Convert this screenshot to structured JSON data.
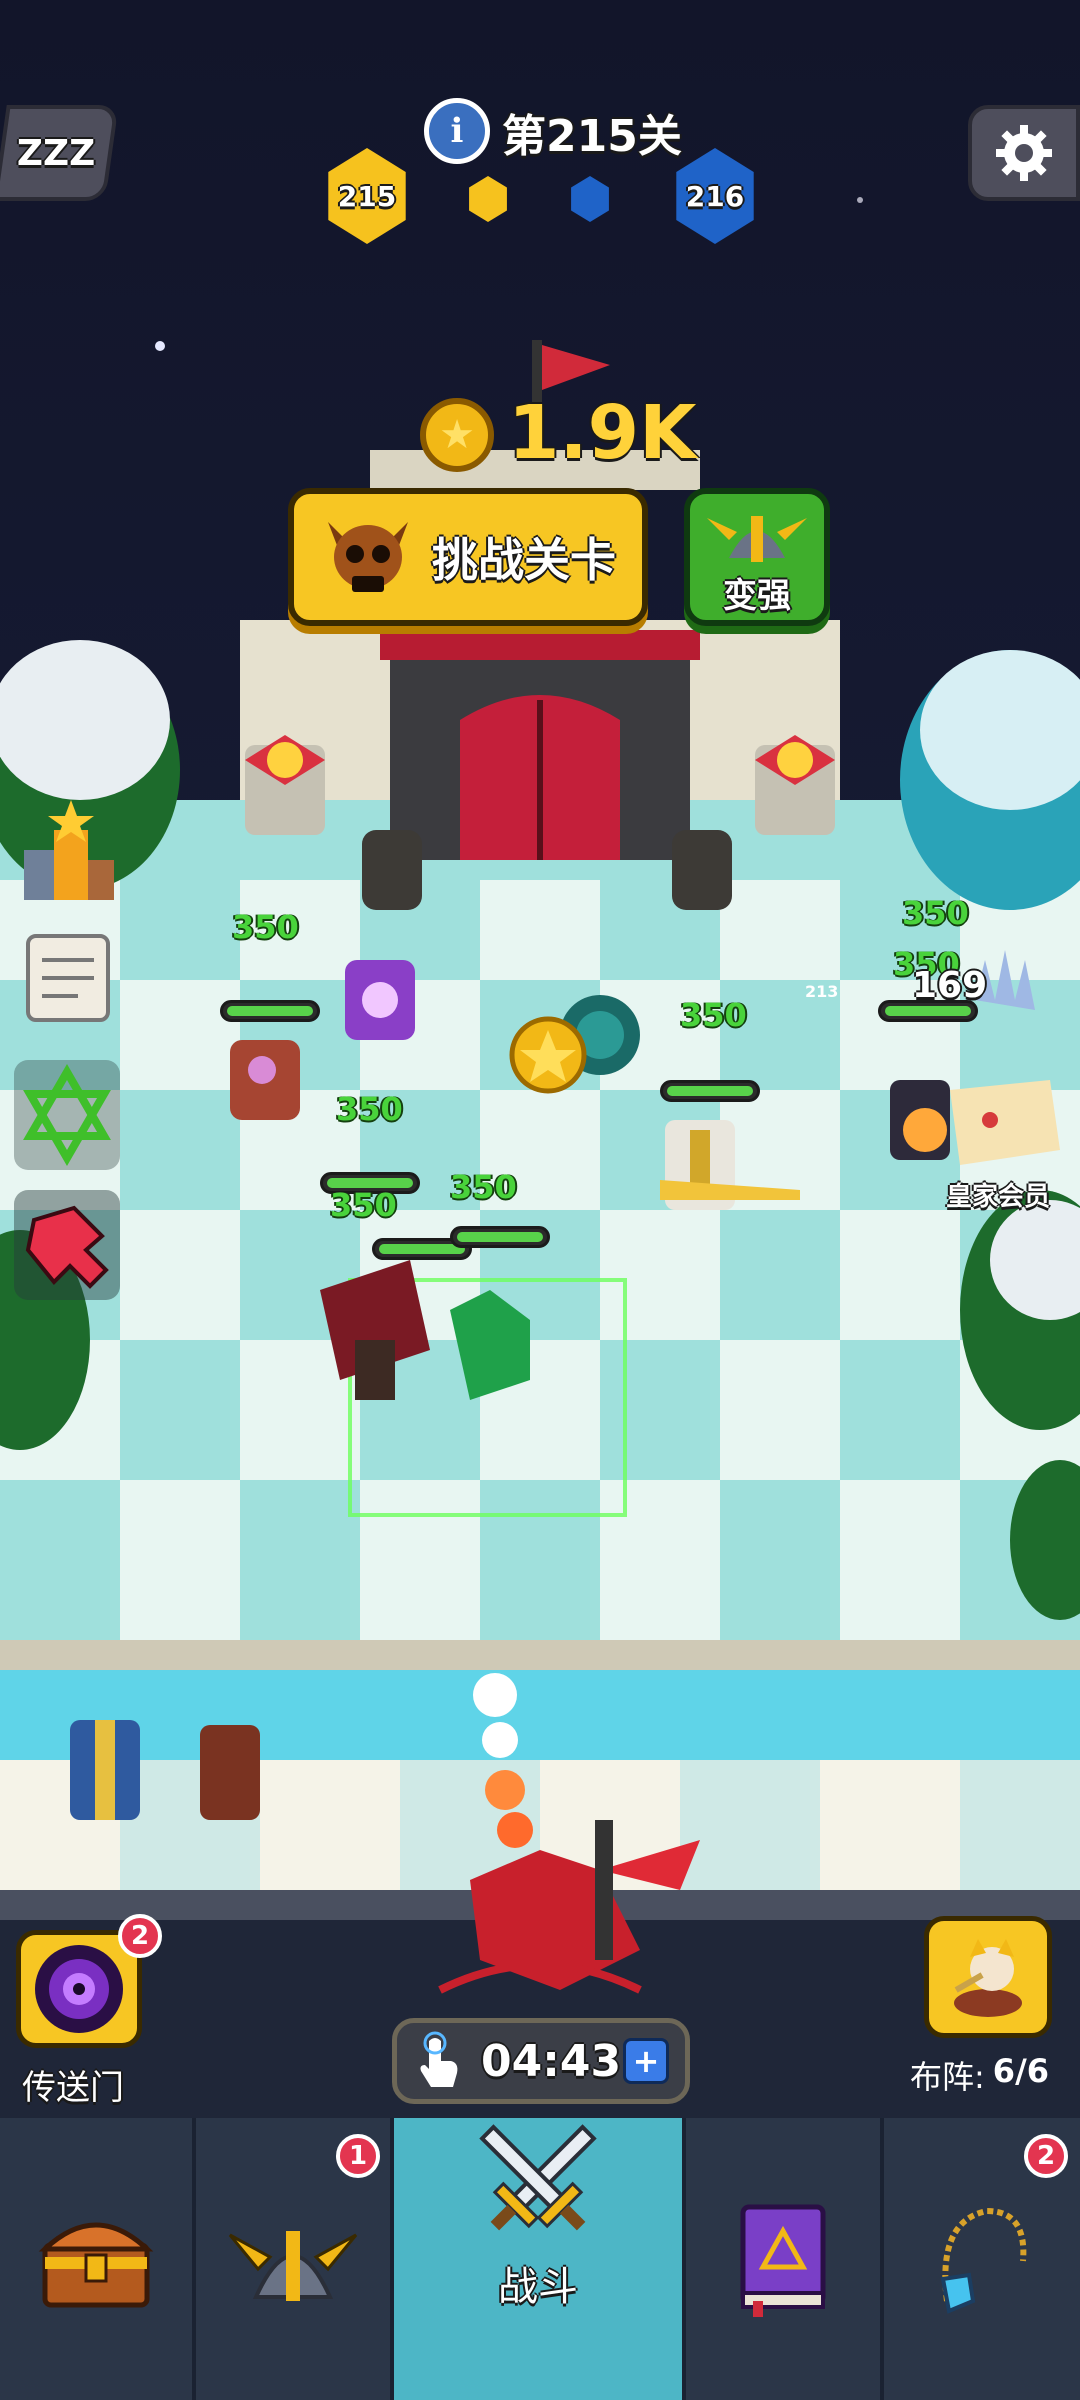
{
  "header": {
    "level_text": "第215关",
    "current_level": "215",
    "next_level": "216"
  },
  "reward": {
    "coins": "1.9K"
  },
  "actions": {
    "challenge_label": "挑战关卡",
    "upgrade_label": "变强"
  },
  "battle": {
    "damage_numbers": [
      "350",
      "350",
      "350",
      "350",
      "350",
      "350",
      "350",
      "350"
    ],
    "small_number": "213",
    "enemy_count": "169"
  },
  "side": {
    "royal_member_label": "皇家会员"
  },
  "portal": {
    "label": "传送门",
    "badge": "2"
  },
  "timer": {
    "value": "04:43"
  },
  "formation": {
    "label": "布阵:",
    "value": "6/6"
  },
  "nav": {
    "tabs": [
      {
        "label": "",
        "icon": "treasure-chest-icon",
        "badge": ""
      },
      {
        "label": "",
        "icon": "viking-helmet-icon",
        "badge": "1"
      },
      {
        "label": "战斗",
        "icon": "crossed-swords-icon",
        "badge": ""
      },
      {
        "label": "",
        "icon": "spellbook-icon",
        "badge": ""
      },
      {
        "label": "",
        "icon": "amulet-icon",
        "badge": "2"
      }
    ]
  },
  "colors": {
    "accent_yellow": "#f6c21e",
    "accent_blue": "#1f63c8",
    "nav_active": "#4db6c6",
    "green_button": "#3fae2c",
    "badge_red": "#e33550"
  }
}
